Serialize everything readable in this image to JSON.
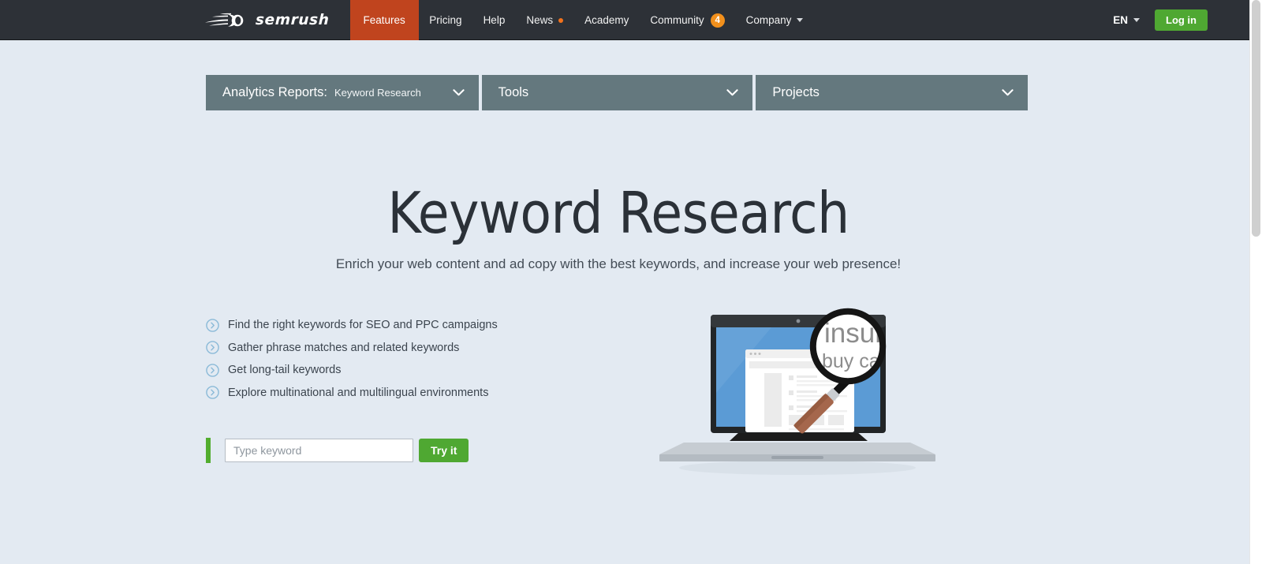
{
  "header": {
    "brand": {
      "name": "semrush",
      "icon": "semrush-comet-logo"
    },
    "nav": [
      {
        "label": "Features",
        "active": true
      },
      {
        "label": "Pricing",
        "active": false
      },
      {
        "label": "Help",
        "active": false
      },
      {
        "label": "News",
        "active": false,
        "dot": true
      },
      {
        "label": "Academy",
        "active": false
      },
      {
        "label": "Community",
        "active": false,
        "badge": "4"
      },
      {
        "label": "Company",
        "active": false,
        "caret": true
      }
    ],
    "language": "EN",
    "login_label": "Log in",
    "accent_active": "#c0441e",
    "accent_login": "#4fa832",
    "badge_color": "#f2901c",
    "background": "#2d3137"
  },
  "subnav": {
    "background": "#64787e",
    "panels": [
      {
        "label": "Analytics Reports:",
        "value": "Keyword Research",
        "chevron": "chevron-down-icon"
      },
      {
        "label": "Tools",
        "value": "",
        "chevron": "chevron-down-icon"
      },
      {
        "label": "Projects",
        "value": "",
        "chevron": "chevron-down-icon"
      }
    ]
  },
  "hero": {
    "title": "Keyword Research",
    "subtitle": "Enrich your web content and ad copy with the best keywords, and increase your web presence!"
  },
  "features": {
    "bullet_icon": "chevron-circle-right-icon",
    "bullet_color": "#89b8d6",
    "items": [
      "Find the right keywords for SEO and PPC campaigns",
      "Gather phrase matches and related keywords",
      "Get long-tail keywords",
      "Explore multinational and multilingual environments"
    ]
  },
  "search": {
    "placeholder": "Type keyword",
    "value": "",
    "button_label": "Try it",
    "accent": "#52ad2e"
  },
  "illustration": {
    "name": "laptop-with-magnifying-glass",
    "magnifier_text_line1": "insura",
    "magnifier_text_line2": "buy car onl",
    "screen_color": "#5b9bd5",
    "page_background": "#e3eaf2"
  }
}
